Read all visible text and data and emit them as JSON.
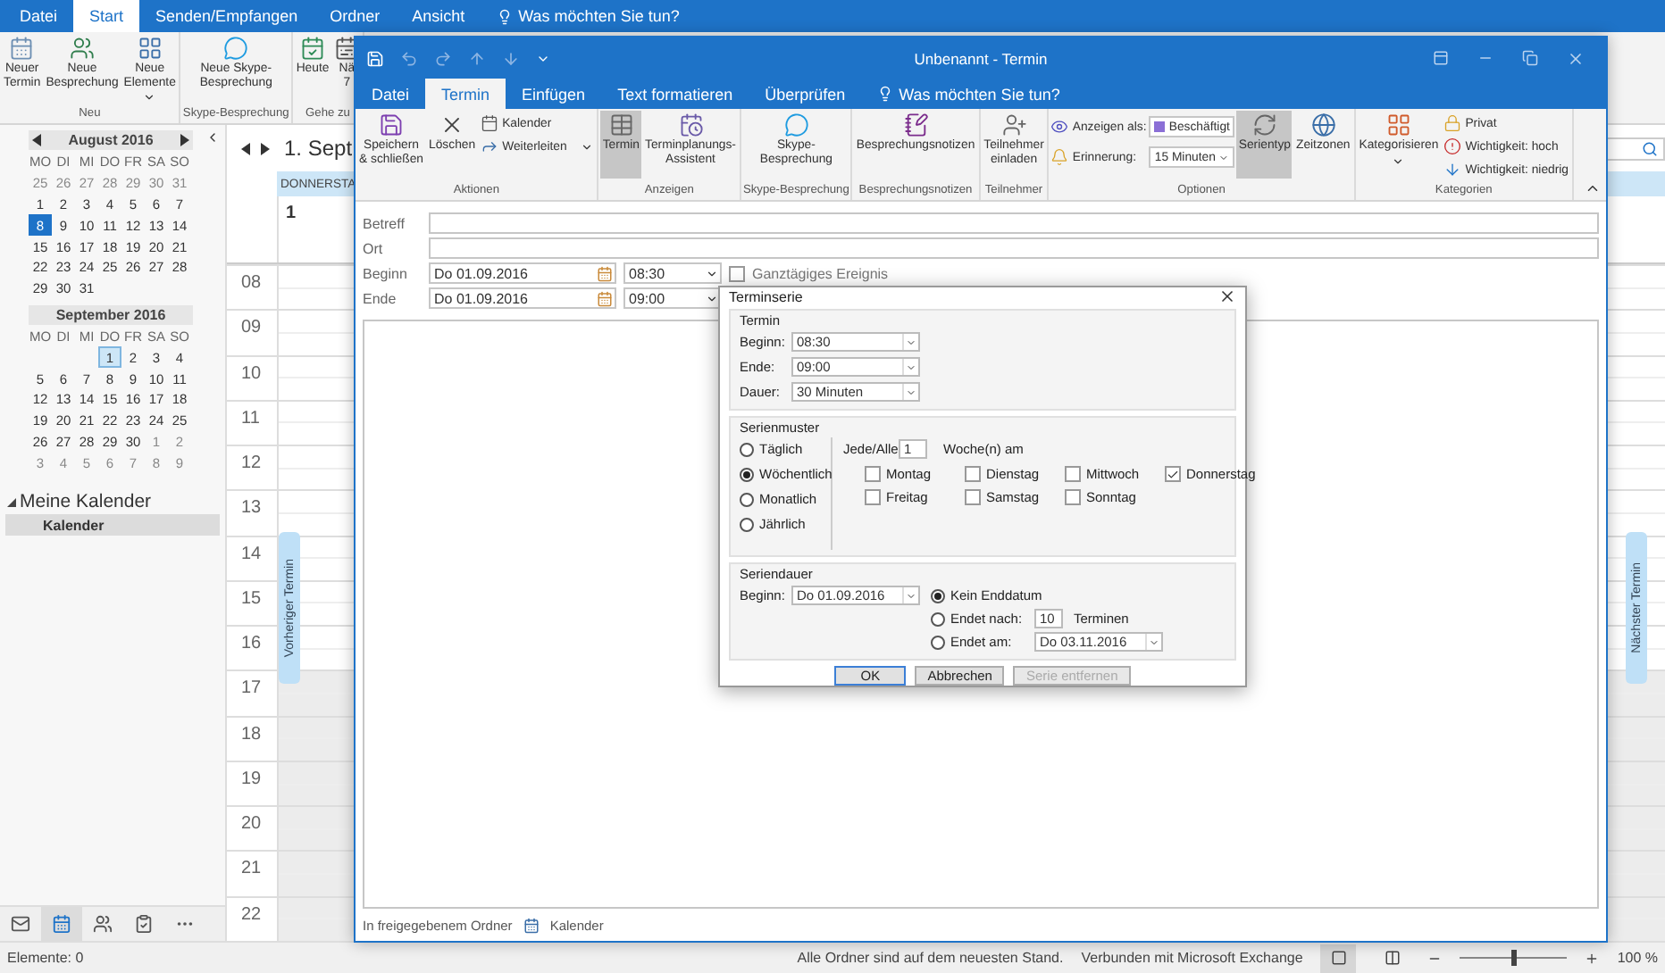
{
  "main_tabs": [
    {
      "label": "Datei",
      "selected": false
    },
    {
      "label": "Start",
      "selected": true
    },
    {
      "label": "Senden/Empfangen",
      "selected": false
    },
    {
      "label": "Ordner",
      "selected": false
    },
    {
      "label": "Ansicht",
      "selected": false
    }
  ],
  "main_tell_me": "Was möchten Sie tun?",
  "main_ribbon": [
    {
      "label": "Neu",
      "items": [
        {
          "kind": "large",
          "label": "Neuer\nTermin"
        },
        {
          "kind": "large",
          "label": "Neue\nBesprechung"
        },
        {
          "kind": "large-menu",
          "label": "Neue\nElemente"
        }
      ]
    },
    {
      "label": "Skype-Besprechung",
      "items": [
        {
          "kind": "large",
          "label": "Neue Skype-\nBesprechung"
        }
      ]
    },
    {
      "label": "Gehe zu",
      "items": [
        {
          "kind": "large",
          "label": "Heute"
        },
        {
          "kind": "large",
          "label": "Nä\n7"
        }
      ]
    }
  ],
  "mini_calendars": [
    {
      "title": "August 2016",
      "weekdays": [
        "MO",
        "DI",
        "MI",
        "DO",
        "FR",
        "SA",
        "SO"
      ],
      "weeks": [
        [
          {
            "day": "25",
            "other": true,
            "today": false,
            "selected": false
          },
          {
            "day": "26",
            "other": true,
            "today": false,
            "selected": false
          },
          {
            "day": "27",
            "other": true,
            "today": false,
            "selected": false
          },
          {
            "day": "28",
            "other": true,
            "today": false,
            "selected": false
          },
          {
            "day": "29",
            "other": true,
            "today": false,
            "selected": false
          },
          {
            "day": "30",
            "other": true,
            "today": false,
            "selected": false
          },
          {
            "day": "31",
            "other": true,
            "today": false,
            "selected": false
          }
        ],
        [
          {
            "day": "1",
            "other": false,
            "today": false,
            "selected": false
          },
          {
            "day": "2",
            "other": false,
            "today": false,
            "selected": false
          },
          {
            "day": "3",
            "other": false,
            "today": false,
            "selected": false
          },
          {
            "day": "4",
            "other": false,
            "today": false,
            "selected": false
          },
          {
            "day": "5",
            "other": false,
            "today": false,
            "selected": false
          },
          {
            "day": "6",
            "other": false,
            "today": false,
            "selected": false
          },
          {
            "day": "7",
            "other": false,
            "today": false,
            "selected": false
          }
        ],
        [
          {
            "day": "8",
            "other": false,
            "today": true,
            "selected": false
          },
          {
            "day": "9",
            "other": false,
            "today": false,
            "selected": false
          },
          {
            "day": "10",
            "other": false,
            "today": false,
            "selected": false
          },
          {
            "day": "11",
            "other": false,
            "today": false,
            "selected": false
          },
          {
            "day": "12",
            "other": false,
            "today": false,
            "selected": false
          },
          {
            "day": "13",
            "other": false,
            "today": false,
            "selected": false
          },
          {
            "day": "14",
            "other": false,
            "today": false,
            "selected": false
          }
        ],
        [
          {
            "day": "15",
            "other": false,
            "today": false,
            "selected": false
          },
          {
            "day": "16",
            "other": false,
            "today": false,
            "selected": false
          },
          {
            "day": "17",
            "other": false,
            "today": false,
            "selected": false
          },
          {
            "day": "18",
            "other": false,
            "today": false,
            "selected": false
          },
          {
            "day": "19",
            "other": false,
            "today": false,
            "selected": false
          },
          {
            "day": "20",
            "other": false,
            "today": false,
            "selected": false
          },
          {
            "day": "21",
            "other": false,
            "today": false,
            "selected": false
          }
        ],
        [
          {
            "day": "22",
            "other": false,
            "today": false,
            "selected": false
          },
          {
            "day": "23",
            "other": false,
            "today": false,
            "selected": false
          },
          {
            "day": "24",
            "other": false,
            "today": false,
            "selected": false
          },
          {
            "day": "25",
            "other": false,
            "today": false,
            "selected": false
          },
          {
            "day": "26",
            "other": false,
            "today": false,
            "selected": false
          },
          {
            "day": "27",
            "other": false,
            "today": false,
            "selected": false
          },
          {
            "day": "28",
            "other": false,
            "today": false,
            "selected": false
          }
        ],
        [
          {
            "day": "29",
            "other": false,
            "today": false,
            "selected": false
          },
          {
            "day": "30",
            "other": false,
            "today": false,
            "selected": false
          },
          {
            "day": "31",
            "other": false,
            "today": false,
            "selected": false
          }
        ]
      ]
    },
    {
      "title": "September 2016",
      "weekdays": [
        "MO",
        "DI",
        "MI",
        "DO",
        "FR",
        "SA",
        "SO"
      ],
      "weeks": [
        [
          {
            "day": "1",
            "other": false,
            "today": false,
            "selected": true
          },
          {
            "day": "2",
            "other": false,
            "today": false,
            "selected": false
          },
          {
            "day": "3",
            "other": false,
            "today": false,
            "selected": false
          },
          {
            "day": "4",
            "other": false,
            "today": false,
            "selected": false
          }
        ],
        [
          {
            "day": "5",
            "other": false,
            "today": false,
            "selected": false
          },
          {
            "day": "6",
            "other": false,
            "today": false,
            "selected": false
          },
          {
            "day": "7",
            "other": false,
            "today": false,
            "selected": false
          },
          {
            "day": "8",
            "other": false,
            "today": false,
            "selected": false
          },
          {
            "day": "9",
            "other": false,
            "today": false,
            "selected": false
          },
          {
            "day": "10",
            "other": false,
            "today": false,
            "selected": false
          },
          {
            "day": "11",
            "other": false,
            "today": false,
            "selected": false
          }
        ],
        [
          {
            "day": "12",
            "other": false,
            "today": false,
            "selected": false
          },
          {
            "day": "13",
            "other": false,
            "today": false,
            "selected": false
          },
          {
            "day": "14",
            "other": false,
            "today": false,
            "selected": false
          },
          {
            "day": "15",
            "other": false,
            "today": false,
            "selected": false
          },
          {
            "day": "16",
            "other": false,
            "today": false,
            "selected": false
          },
          {
            "day": "17",
            "other": false,
            "today": false,
            "selected": false
          },
          {
            "day": "18",
            "other": false,
            "today": false,
            "selected": false
          }
        ],
        [
          {
            "day": "19",
            "other": false,
            "today": false,
            "selected": false
          },
          {
            "day": "20",
            "other": false,
            "today": false,
            "selected": false
          },
          {
            "day": "21",
            "other": false,
            "today": false,
            "selected": false
          },
          {
            "day": "22",
            "other": false,
            "today": false,
            "selected": false
          },
          {
            "day": "23",
            "other": false,
            "today": false,
            "selected": false
          },
          {
            "day": "24",
            "other": false,
            "today": false,
            "selected": false
          },
          {
            "day": "25",
            "other": false,
            "today": false,
            "selected": false
          }
        ],
        [
          {
            "day": "26",
            "other": false,
            "today": false,
            "selected": false
          },
          {
            "day": "27",
            "other": false,
            "today": false,
            "selected": false
          },
          {
            "day": "28",
            "other": false,
            "today": false,
            "selected": false
          },
          {
            "day": "29",
            "other": false,
            "today": false,
            "selected": false
          },
          {
            "day": "30",
            "other": false,
            "today": false,
            "selected": false
          },
          {
            "day": "1",
            "other": true,
            "today": false,
            "selected": false
          },
          {
            "day": "2",
            "other": true,
            "today": false,
            "selected": false
          }
        ],
        [
          {
            "day": "3",
            "other": true,
            "today": false,
            "selected": false
          },
          {
            "day": "4",
            "other": true,
            "today": false,
            "selected": false
          },
          {
            "day": "5",
            "other": true,
            "today": false,
            "selected": false
          },
          {
            "day": "6",
            "other": true,
            "today": false,
            "selected": false
          },
          {
            "day": "7",
            "other": true,
            "today": false,
            "selected": false
          },
          {
            "day": "8",
            "other": true,
            "today": false,
            "selected": false
          },
          {
            "day": "9",
            "other": true,
            "today": false,
            "selected": false
          }
        ]
      ]
    }
  ],
  "folders": {
    "heading": "Meine Kalender",
    "expanded": true,
    "items": [
      {
        "label": "Kalender",
        "selected": true
      }
    ]
  },
  "nav_bar": [
    {
      "selected": false
    },
    {
      "selected": true
    },
    {
      "selected": false
    },
    {
      "selected": false
    },
    {
      "selected": false
    }
  ],
  "calendar_view": {
    "title": "1. Sept",
    "day_header": "DONNERSTA",
    "day_number": "1",
    "previous_tab": "Vorheriger Termin",
    "next_tab": "Nächster Termin",
    "hours": [
      {
        "label": "08",
        "working": true
      },
      {
        "label": "09",
        "working": true
      },
      {
        "label": "10",
        "working": true
      },
      {
        "label": "11",
        "working": true
      },
      {
        "label": "12",
        "working": true
      },
      {
        "label": "13",
        "working": true
      },
      {
        "label": "14",
        "working": true
      },
      {
        "label": "15",
        "working": true
      },
      {
        "label": "16",
        "working": true
      },
      {
        "label": "17",
        "working": false
      },
      {
        "label": "18",
        "working": false
      },
      {
        "label": "19",
        "working": false
      },
      {
        "label": "20",
        "working": false
      },
      {
        "label": "21",
        "working": false
      },
      {
        "label": "22",
        "working": false
      }
    ]
  },
  "status_bar": {
    "items": "Elemente: 0",
    "sync": "Alle Ordner sind auf dem neuesten Stand.",
    "connection": "Verbunden mit Microsoft Exchange",
    "zoom": "100 %",
    "zoom_slider": {
      "level": 0.5
    }
  },
  "appointment": {
    "title": "Unbenannt - Termin",
    "tabs": [
      {
        "label": "Datei",
        "selected": false
      },
      {
        "label": "Termin",
        "selected": true
      },
      {
        "label": "Einfügen",
        "selected": false
      },
      {
        "label": "Text formatieren",
        "selected": false
      },
      {
        "label": "Überprüfen",
        "selected": false
      }
    ],
    "tell_me": "Was möchten Sie tun?",
    "ribbon": [
      {
        "label": "Aktionen",
        "items": [
          {
            "kind": "large",
            "label": "Speichern\n& schließen",
            "selected": false
          },
          {
            "kind": "large",
            "label": "Löschen",
            "selected": false
          },
          {
            "kind": "small",
            "label": "Kalender"
          },
          {
            "kind": "small-menu",
            "label": "Weiterleiten"
          }
        ]
      },
      {
        "label": "Anzeigen",
        "items": [
          {
            "kind": "large",
            "label": "Termin",
            "selected": true
          },
          {
            "kind": "large",
            "label": "Terminplanungs-\nAssistent",
            "selected": false
          }
        ]
      },
      {
        "label": "Skype-Besprechung",
        "items": [
          {
            "kind": "large",
            "label": "Skype-\nBesprechung",
            "selected": false
          }
        ]
      },
      {
        "label": "Besprechungsnotizen",
        "items": [
          {
            "kind": "large",
            "label": "Besprechungsnotizen",
            "selected": false
          }
        ]
      },
      {
        "label": "Teilnehmer",
        "items": [
          {
            "kind": "large",
            "label": "Teilnehmer\neinladen",
            "selected": false
          }
        ]
      },
      {
        "label": "Optionen",
        "items": [
          {
            "kind": "field",
            "label": "Anzeigen als:",
            "value": "Beschäftigt"
          },
          {
            "kind": "field",
            "label": "Erinnerung:",
            "value": "15 Minuten"
          },
          {
            "kind": "large",
            "label": "Serientyp",
            "selected": true
          },
          {
            "kind": "large",
            "label": "Zeitzonen",
            "selected": false
          }
        ]
      },
      {
        "label": "Kategorien",
        "items": [
          {
            "kind": "large-menu",
            "label": "Kategorisieren",
            "selected": false
          },
          {
            "kind": "small",
            "label": "Privat"
          },
          {
            "kind": "small",
            "label": "Wichtigkeit: hoch"
          },
          {
            "kind": "small",
            "label": "Wichtigkeit: niedrig"
          }
        ]
      }
    ],
    "form": {
      "fields": [
        {
          "label": "Betreff"
        },
        {
          "label": "Ort"
        }
      ],
      "times": [
        {
          "label": "Beginn",
          "date": "Do 01.09.2016",
          "time": "08:30"
        },
        {
          "label": "Ende",
          "date": "Do 01.09.2016",
          "time": "09:00"
        }
      ],
      "all_day": {
        "label": "Ganztägiges Ereignis",
        "checked": false
      }
    },
    "footer": {
      "label": "In freigegebenem Ordner",
      "folder": "Kalender"
    }
  },
  "dialog": {
    "title": "Terminserie",
    "appointment": {
      "heading": "Termin",
      "rows": [
        {
          "label": "Beginn:",
          "value": "08:30"
        },
        {
          "label": "Ende:",
          "value": "09:00"
        },
        {
          "label": "Dauer:",
          "value": "30 Minuten"
        }
      ]
    },
    "pattern": {
      "heading": "Serienmuster",
      "options": [
        {
          "label": "Täglich",
          "selected": false
        },
        {
          "label": "Wöchentlich",
          "selected": true
        },
        {
          "label": "Monatlich",
          "selected": false
        },
        {
          "label": "Jährlich",
          "selected": false
        }
      ],
      "every_label": "Jede/Alle",
      "every_value": "1",
      "unit": "Woche(n) am",
      "days": [
        {
          "label": "Montag",
          "checked": false
        },
        {
          "label": "Dienstag",
          "checked": false
        },
        {
          "label": "Mittwoch",
          "checked": false
        },
        {
          "label": "Donnerstag",
          "checked": true
        },
        {
          "label": "Freitag",
          "checked": false
        },
        {
          "label": "Samstag",
          "checked": false
        },
        {
          "label": "Sonntag",
          "checked": false
        }
      ]
    },
    "range": {
      "heading": "Seriendauer",
      "start_label": "Beginn:",
      "start": "Do 01.09.2016",
      "options": [
        {
          "kind": "none",
          "label": "Kein Enddatum",
          "selected": true
        },
        {
          "kind": "count",
          "label": "Endet nach:",
          "selected": false,
          "value": "10",
          "unit": "Terminen"
        },
        {
          "kind": "date",
          "label": "Endet am:",
          "selected": false,
          "value": "Do 03.11.2016"
        }
      ]
    },
    "buttons": [
      {
        "label": "OK",
        "kind": "default",
        "disabled": false
      },
      {
        "label": "Abbrechen",
        "kind": "normal",
        "disabled": false
      },
      {
        "label": "Serie entfernen",
        "kind": "normal",
        "disabled": true
      }
    ]
  }
}
